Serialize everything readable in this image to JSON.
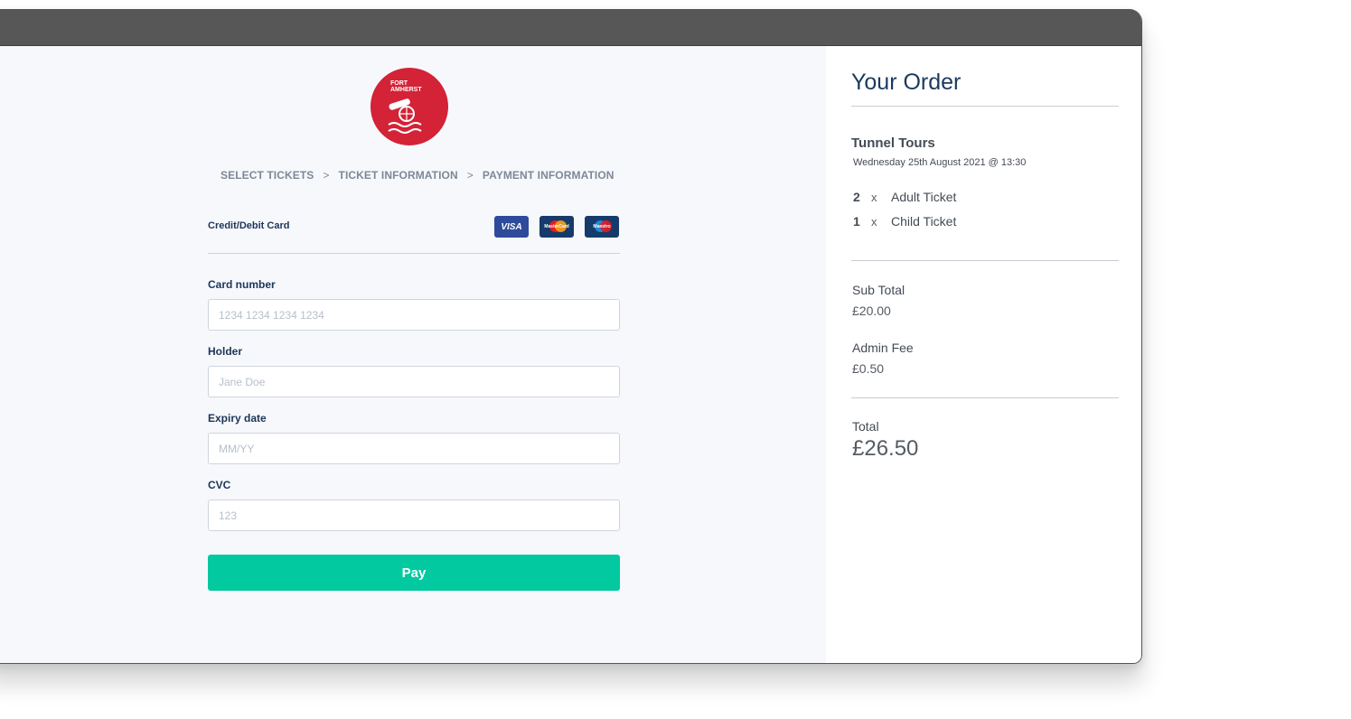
{
  "logo": {
    "line1": "FORT",
    "line2": "AMHERST"
  },
  "breadcrumb": {
    "steps": [
      "SELECT TICKETS",
      "TICKET INFORMATION",
      "PAYMENT INFORMATION"
    ],
    "separator": ">"
  },
  "payment": {
    "method_label": "Credit/Debit Card",
    "card_brands": [
      "VISA",
      "MasterCard",
      "Maestro"
    ],
    "fields": {
      "card_number": {
        "label": "Card number",
        "placeholder": "1234 1234 1234 1234"
      },
      "holder": {
        "label": "Holder",
        "placeholder": "Jane Doe"
      },
      "expiry": {
        "label": "Expiry date",
        "placeholder": "MM/YY"
      },
      "cvc": {
        "label": "CVC",
        "placeholder": "123"
      }
    },
    "pay_label": "Pay"
  },
  "order": {
    "title": "Your Order",
    "event_name": "Tunnel Tours",
    "event_date": "Wednesday 25th August 2021 @ 13:30",
    "tickets": [
      {
        "qty": "2",
        "x": "x",
        "name": "Adult Ticket"
      },
      {
        "qty": "1",
        "x": "x",
        "name": "Child Ticket"
      }
    ],
    "subtotal_label": "Sub Total",
    "subtotal_value": "£20.00",
    "admin_fee_label": "Admin Fee",
    "admin_fee_value": "£0.50",
    "total_label": "Total",
    "total_value": "£26.50"
  },
  "colors": {
    "brand_red": "#d42236",
    "pay_button": "#02c9a0",
    "heading_navy": "#1b3a5c"
  }
}
